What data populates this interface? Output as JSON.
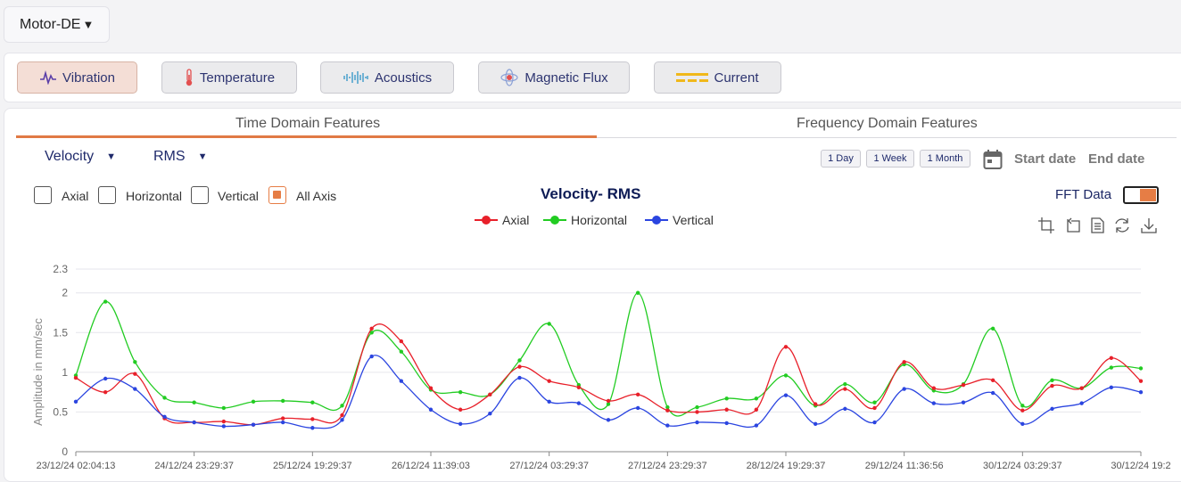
{
  "asset_selector": {
    "value": "Motor-DE",
    "icon": "caret-down-icon"
  },
  "sensors": [
    {
      "label": "Vibration",
      "icon": "vibration-wave-icon",
      "active": true
    },
    {
      "label": "Temperature",
      "icon": "thermometer-icon",
      "active": false
    },
    {
      "label": "Acoustics",
      "icon": "sound-wave-icon",
      "active": false
    },
    {
      "label": "Magnetic Flux",
      "icon": "magnet-flux-icon",
      "active": false
    },
    {
      "label": "Current",
      "icon": "current-lines-icon",
      "active": false
    }
  ],
  "tabs": [
    {
      "label": "Time Domain Features",
      "active": true
    },
    {
      "label": "Frequency Domain Features",
      "active": false
    }
  ],
  "filters": {
    "metric": "Velocity",
    "statistic": "RMS"
  },
  "ranges": [
    "1 Day",
    "1 Week",
    "1 Month"
  ],
  "dates": {
    "start": "Start date",
    "end": "End date",
    "icon": "calendar-icon"
  },
  "axes_toggle": [
    {
      "label": "Axial",
      "checked": false
    },
    {
      "label": "Horizontal",
      "checked": false
    },
    {
      "label": "Vertical",
      "checked": false
    },
    {
      "label": "All Axis",
      "checked": true
    }
  ],
  "fft": {
    "label": "FFT Data",
    "on": true
  },
  "toolbox": [
    "zoom-icon",
    "zoom-reset-icon",
    "data-view-icon",
    "restore-icon",
    "download-icon"
  ],
  "colors": {
    "accent": "#e67d45",
    "axial": "#e8202a",
    "horizontal": "#22cc22",
    "vertical": "#2b45e0"
  },
  "chart_data": {
    "type": "line",
    "title": "Velocity- RMS",
    "ylabel": "Amplitude in mm/sec",
    "xlabel": "",
    "ylim": [
      0,
      2.3
    ],
    "yticks": [
      0,
      0.5,
      1,
      1.5,
      2,
      2.3
    ],
    "grid": true,
    "legend_position": "top-center",
    "xtick_labels": [
      "23/12/24 02:04:13",
      "24/12/24 23:29:37",
      "25/12/24 19:29:37",
      "26/12/24 11:39:03",
      "27/12/24 03:29:37",
      "27/12/24 23:29:37",
      "28/12/24 19:29:37",
      "29/12/24 11:36:56",
      "30/12/24 03:29:37",
      "30/12/24 19:2"
    ],
    "series": [
      {
        "name": "Axial",
        "color": "#e8202a",
        "values": [
          0.93,
          0.75,
          0.98,
          0.42,
          0.37,
          0.38,
          0.34,
          0.42,
          0.41,
          0.46,
          1.55,
          1.39,
          0.8,
          0.53,
          0.72,
          1.07,
          0.89,
          0.81,
          0.64,
          0.72,
          0.52,
          0.5,
          0.53,
          0.53,
          1.32,
          0.6,
          0.79,
          0.55,
          1.13,
          0.8,
          0.84,
          0.9,
          0.52,
          0.83,
          0.8,
          1.18,
          0.89
        ]
      },
      {
        "name": "Horizontal",
        "color": "#22cc22",
        "values": [
          0.96,
          1.89,
          1.13,
          0.68,
          0.62,
          0.55,
          0.63,
          0.64,
          0.62,
          0.58,
          1.5,
          1.26,
          0.78,
          0.75,
          0.72,
          1.15,
          1.61,
          0.84,
          0.6,
          2.0,
          0.56,
          0.56,
          0.67,
          0.67,
          0.96,
          0.58,
          0.85,
          0.62,
          1.1,
          0.77,
          0.85,
          1.55,
          0.58,
          0.9,
          0.8,
          1.06,
          1.05
        ]
      },
      {
        "name": "Vertical",
        "color": "#2b45e0",
        "values": [
          0.63,
          0.92,
          0.79,
          0.44,
          0.37,
          0.32,
          0.34,
          0.37,
          0.3,
          0.4,
          1.2,
          0.89,
          0.53,
          0.35,
          0.48,
          0.93,
          0.63,
          0.61,
          0.4,
          0.55,
          0.33,
          0.37,
          0.36,
          0.33,
          0.71,
          0.35,
          0.54,
          0.37,
          0.79,
          0.61,
          0.62,
          0.74,
          0.35,
          0.54,
          0.61,
          0.81,
          0.75
        ]
      }
    ]
  }
}
